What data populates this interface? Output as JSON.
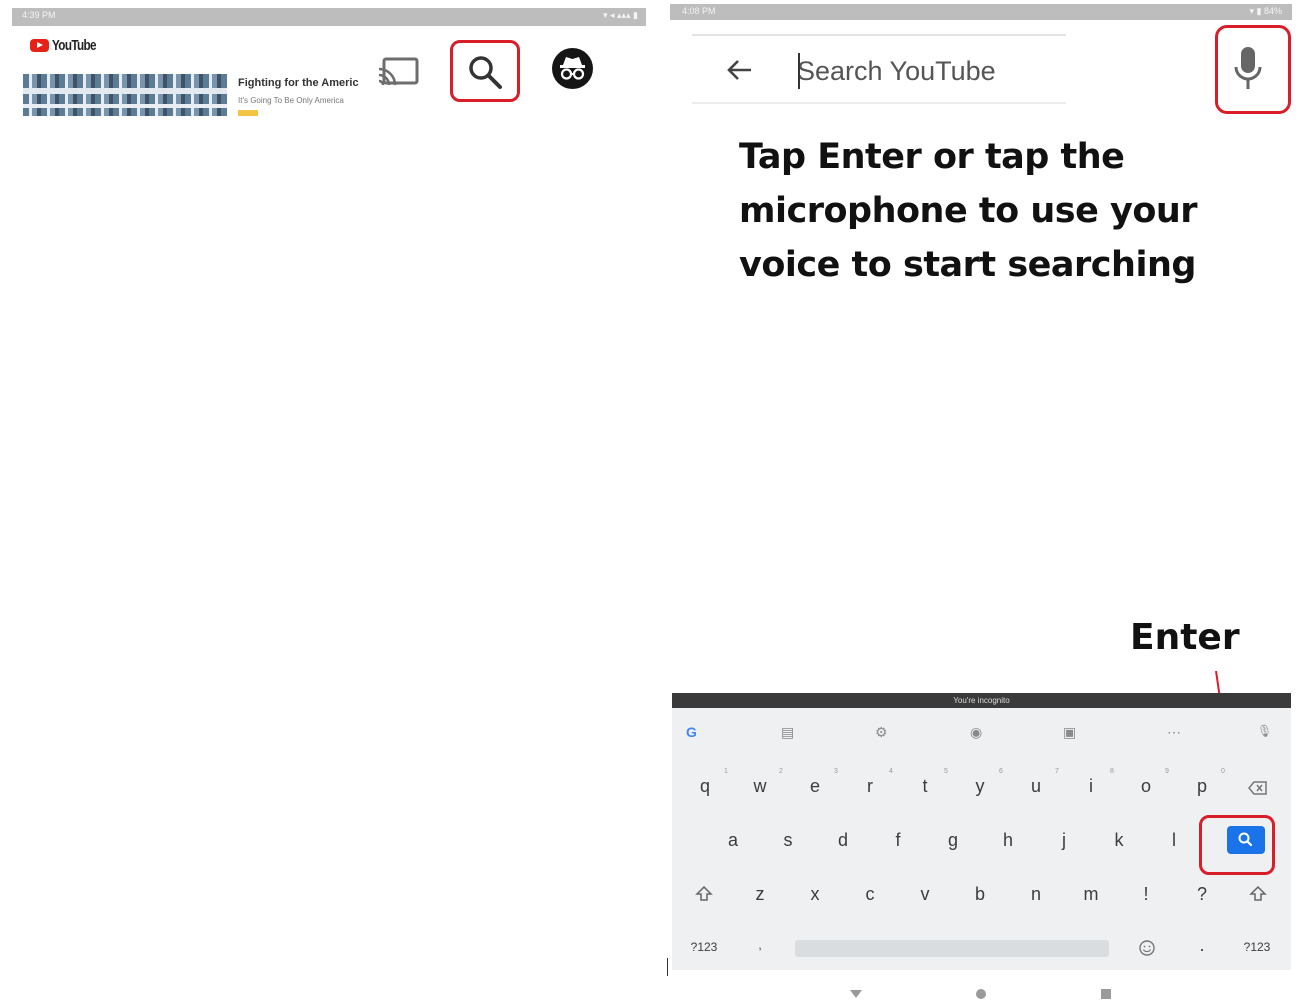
{
  "left": {
    "status_time": "4:39 PM",
    "status_icons": "▾ ◂ ▴▴▴ ▮",
    "logo_text": "YouTube",
    "video": {
      "title": "Fighting for the Americ",
      "subtitle": "It's Going To Be Only America"
    }
  },
  "right": {
    "status_time": "4:08 PM",
    "status_icons": "▾ ▮ 84%",
    "search": {
      "placeholder": "Search YouTube"
    },
    "instruction": "Tap Enter or tap the microphone to use your voice to start searching",
    "enter_label": "Enter",
    "keyboard": {
      "incognito_banner": "You're incognito",
      "toolbar": [
        "G",
        "▤",
        "⚙",
        "◉",
        "▣",
        "⋯",
        "🎙"
      ],
      "row1": [
        "q",
        "w",
        "e",
        "r",
        "t",
        "y",
        "u",
        "i",
        "o",
        "p"
      ],
      "row1_hints": [
        "1",
        "2",
        "3",
        "4",
        "5",
        "6",
        "7",
        "8",
        "9",
        "0"
      ],
      "row2": [
        "a",
        "s",
        "d",
        "f",
        "g",
        "h",
        "j",
        "k",
        "l"
      ],
      "row3": [
        "z",
        "x",
        "c",
        "v",
        "b",
        "n",
        "m",
        "!",
        "?"
      ],
      "symbols_left": "?123",
      "symbols_right": "?123",
      "comma": ",",
      "period": "."
    },
    "annotation_color": "#d91e2a",
    "enter_key_color": "#1a73e8"
  }
}
